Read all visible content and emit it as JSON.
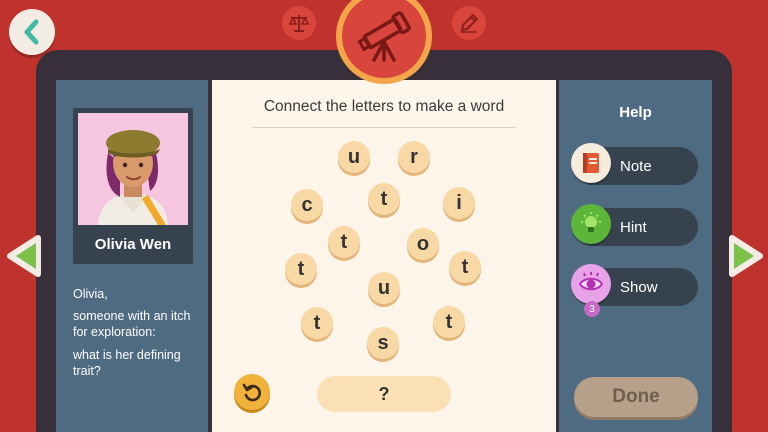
{
  "header": {
    "back_icon": "chevron-left-icon",
    "left_icon": "scales-icon",
    "center_icon": "telescope-icon",
    "right_icon": "pencil-icon"
  },
  "character": {
    "name": "Olivia Wen",
    "prompt_lines": [
      "Olivia,",
      "someone with an itch for exploration:",
      "what is her defining trait?"
    ]
  },
  "puzzle": {
    "instruction": "Connect the letters to make a word",
    "letters": [
      "u",
      "r",
      "c",
      "t",
      "i",
      "t",
      "o",
      "t",
      "t",
      "u",
      "t",
      "t",
      "s"
    ],
    "answer_placeholder": "?"
  },
  "help": {
    "title": "Help",
    "note_label": "Note",
    "hint_label": "Hint",
    "show_label": "Show",
    "show_count": "3"
  },
  "done_label": "Done",
  "colors": {
    "background": "#c0322e",
    "panel": "#4e6b82",
    "tile": "#f8d9a6",
    "accent_orange": "#f4a54a",
    "done_disabled": "#b7a089"
  }
}
